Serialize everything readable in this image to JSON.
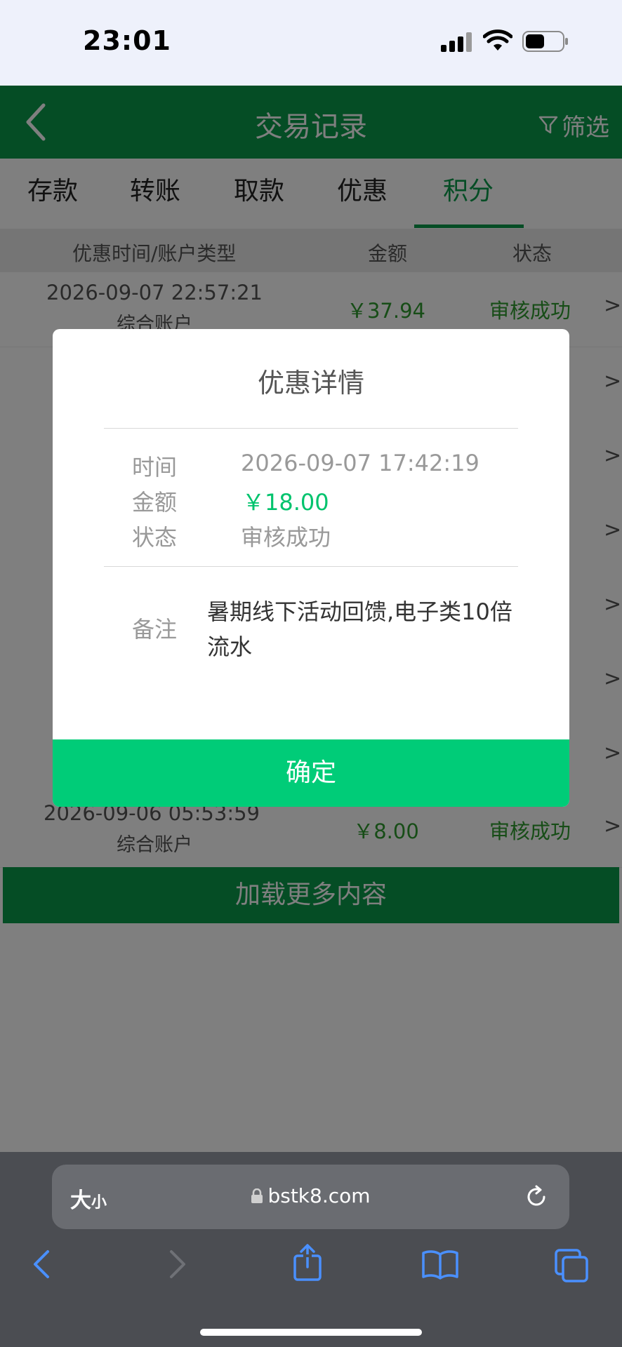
{
  "status_bar": {
    "time": "23:01"
  },
  "header": {
    "title": "交易记录",
    "filter_label": "筛选"
  },
  "tabs": [
    {
      "label": "存款"
    },
    {
      "label": "转账"
    },
    {
      "label": "取款"
    },
    {
      "label": "优惠"
    },
    {
      "label": "积分",
      "active": true
    }
  ],
  "columns": {
    "time_account": "优惠时间/账户类型",
    "amount": "金额",
    "status": "状态"
  },
  "rows": [
    {
      "datetime": "2026-09-07 22:57:21",
      "account": "综合账户",
      "amount": "￥37.94",
      "status": "审核成功"
    },
    {
      "datetime": "2026-09-06 05:53:59",
      "account": "综合账户",
      "amount": "￥8.00",
      "status": "审核成功"
    }
  ],
  "load_more": "加载更多内容",
  "modal": {
    "title": "优惠详情",
    "time_label": "时间",
    "time_value": "2026-09-07 17:42:19",
    "amount_label": "金额",
    "amount_value": "￥18.00",
    "status_label": "状态",
    "status_value": "审核成功",
    "note_label": "备注",
    "note_value": "暑期线下活动回馈,电子类10倍流水",
    "confirm_label": "确定"
  },
  "browser": {
    "text_size_label": "大",
    "text_size_small": "小",
    "url": "bstk8.com"
  },
  "chevron": ">",
  "colors": {
    "brand_green": "#0a9a4a",
    "confirm_green": "#00cc78",
    "amount_green": "#00c36d"
  }
}
